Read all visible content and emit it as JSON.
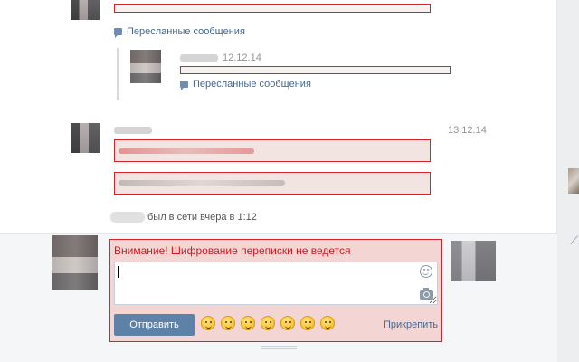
{
  "messages": {
    "forwarded_label_1": "Пересланные сообщения",
    "forwarded_inner_date": "12.12.14",
    "forwarded_label_2": "Пересланные сообщения",
    "message_date": "13.12.14"
  },
  "status": {
    "last_seen": "был в сети вчера в 1:12"
  },
  "composer": {
    "warning": "Внимание! Шифрование переписки не ведется",
    "input_value": "",
    "send_label": "Отправить",
    "attach_label": "Прикрепить",
    "emoji_icons": [
      "laughing-emoji-icon",
      "kiss-emoji-icon",
      "wink-tongue-emoji-icon",
      "smile-emoji-icon",
      "grin-emoji-icon",
      "blush-emoji-icon",
      "surprised-emoji-icon"
    ]
  },
  "colors": {
    "accent": "#5e81a8",
    "warning": "#d01a22",
    "highlight_border": "#d8232a",
    "link": "#45678f"
  }
}
